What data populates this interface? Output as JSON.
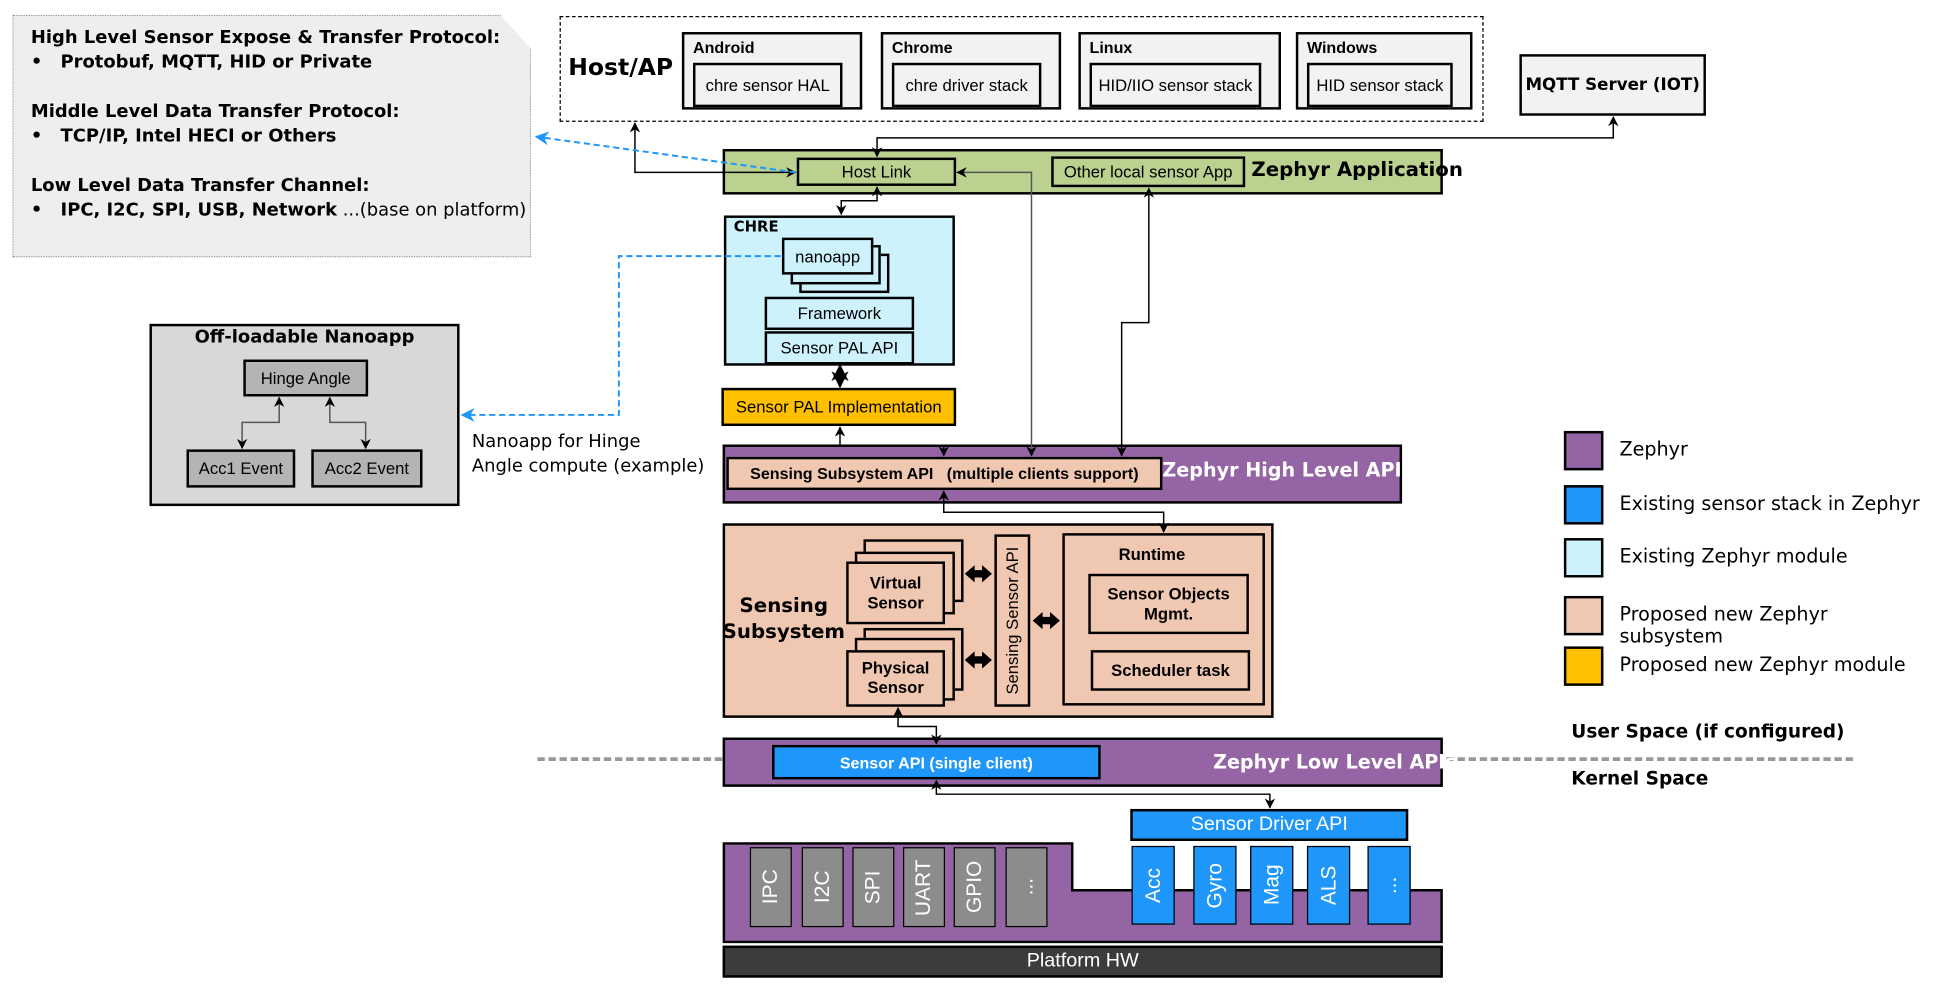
{
  "note": {
    "sections": [
      {
        "heading": "High Level Sensor Expose & Transfer Protocol:",
        "bullet": "Protobuf,  MQTT,  HID  or Private",
        "bullet_suffix": ""
      },
      {
        "heading": "Middle Level Data Transfer Protocol:",
        "bullet": "TCP/IP,  Intel HECI or Others",
        "bullet_suffix": ""
      },
      {
        "heading": "Low  Level Data Transfer Channel:",
        "bullet": "IPC, I2C, SPI, USB, Network",
        "bullet_suffix": " ...(base on platform)"
      }
    ],
    "bullet_char": "•"
  },
  "host": {
    "title": "Host/AP",
    "os": [
      {
        "name": "Android",
        "stack": "chre sensor HAL"
      },
      {
        "name": "Chrome",
        "stack": "chre driver stack"
      },
      {
        "name": "Linux",
        "stack": "HID/IIO sensor stack"
      },
      {
        "name": "Windows",
        "stack": "HID sensor stack"
      }
    ],
    "mqtt": "MQTT Server (IOT)"
  },
  "app": {
    "title": "Zephyr Application",
    "host_link": "Host Link",
    "other_app": "Other local sensor App"
  },
  "chre": {
    "title": "CHRE",
    "nanoapp": "nanoapp",
    "framework": "Framework",
    "pal_api": "Sensor PAL API",
    "pal_impl": "Sensor PAL Implementation"
  },
  "offload": {
    "title": "Off-loadable Nanoapp",
    "hinge": "Hinge Angle",
    "acc1": "Acc1 Event",
    "acc2": "Acc2 Event",
    "caption_line1": "Nanoapp  for Hinge",
    "caption_line2": "Angle compute (example)"
  },
  "high_api": {
    "title": "Zephyr High Level APIs",
    "sensing_api": "Sensing Subsystem API   (multiple clients support)"
  },
  "sensing": {
    "title_line1": "Sensing",
    "title_line2": "Subsystem",
    "virtual_line1": "Virtual",
    "virtual_line2": "Sensor",
    "physical_line1": "Physical",
    "physical_line2": "Sensor",
    "sensor_api": "Sensing Sensor API",
    "runtime": "Runtime",
    "objects_line1": "Sensor Objects",
    "objects_line2": "Mgmt.",
    "scheduler": "Scheduler task"
  },
  "low_api": {
    "title": "Zephyr Low Level APIs",
    "sensor_api": "Sensor API (single client)"
  },
  "drivers": {
    "driver_api": "Sensor Driver API",
    "buses": [
      "IPC",
      "I2C",
      "SPI",
      "UART",
      "GPIO",
      "..."
    ],
    "sensors": [
      "Acc",
      "Gyro",
      "Mag",
      "ALS",
      "..."
    ],
    "platform": "Platform HW"
  },
  "spaces": {
    "user": "User Space (if configured)",
    "kernel": "Kernel Space"
  },
  "legend": [
    {
      "label": "Zephyr",
      "color": "#9464a4"
    },
    {
      "label": "Existing sensor stack in Zephyr",
      "color": "#1e96fa"
    },
    {
      "label": "Existing Zephyr module",
      "color": "#cdf2fc"
    },
    {
      "label": "Proposed new Zephyr subsystem",
      "color": "#f0c8b2"
    },
    {
      "label": "Proposed new Zephyr module",
      "color": "#ffc000"
    }
  ],
  "colors": {
    "zephyr": "#9464a4",
    "existing_stack": "#1e96fa",
    "existing_module": "#cdf2fc",
    "proposed_subsystem": "#f0c8b2",
    "proposed_module": "#ffc000",
    "application": "#bad190",
    "platform": "#3c3c3c",
    "bus": "#8c8c8c"
  }
}
